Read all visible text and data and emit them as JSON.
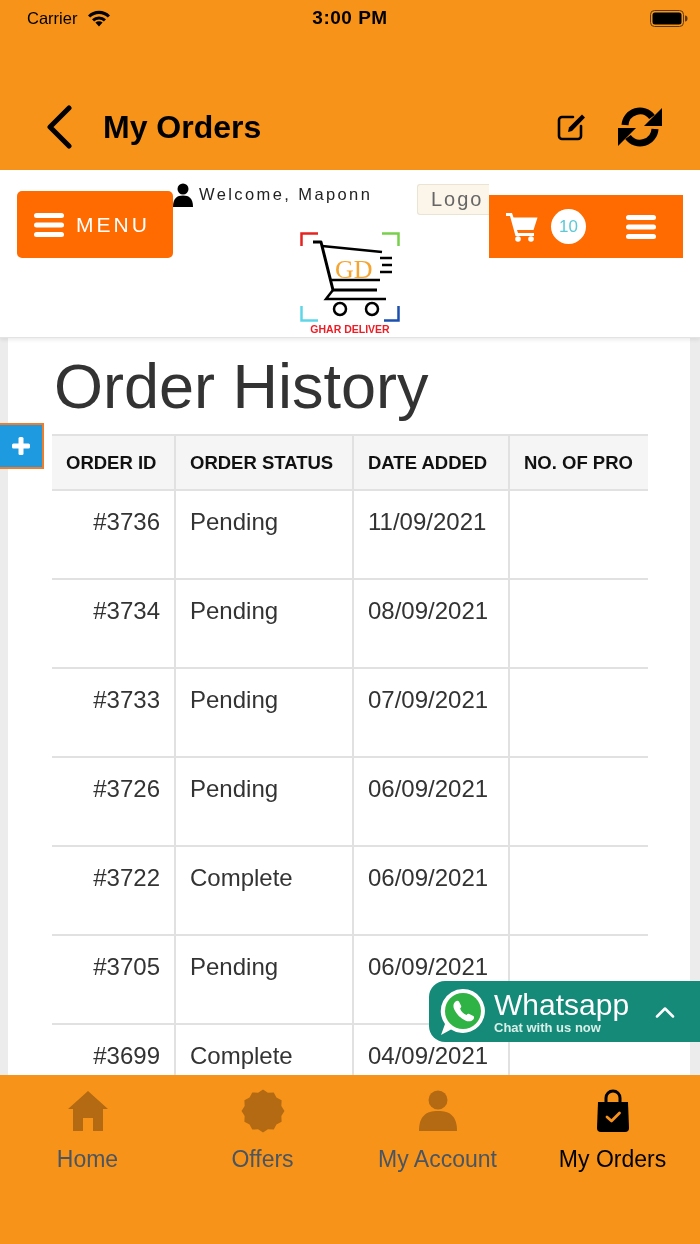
{
  "status_bar": {
    "carrier": "Carrier",
    "time": "3:00 PM"
  },
  "nav_bar": {
    "title": "My Orders"
  },
  "site_header": {
    "menu_button": "MENU",
    "welcome": "Welcome, Maponn",
    "logout_button": "Logo",
    "cart_count": "10",
    "logo_monogram": "GD",
    "logo_caption": "GHAR DELIVER"
  },
  "order_history": {
    "title": "Order History",
    "columns": [
      "ORDER ID",
      "ORDER STATUS",
      "DATE ADDED",
      "NO. OF PRO"
    ],
    "rows": [
      {
        "order_id": "#3736",
        "status": "Pending",
        "date_added": "11/09/2021"
      },
      {
        "order_id": "#3734",
        "status": "Pending",
        "date_added": "08/09/2021"
      },
      {
        "order_id": "#3733",
        "status": "Pending",
        "date_added": "07/09/2021"
      },
      {
        "order_id": "#3726",
        "status": "Pending",
        "date_added": "06/09/2021"
      },
      {
        "order_id": "#3722",
        "status": "Complete",
        "date_added": "06/09/2021"
      },
      {
        "order_id": "#3705",
        "status": "Pending",
        "date_added": "06/09/2021"
      },
      {
        "order_id": "#3699",
        "status": "Complete",
        "date_added": "04/09/2021"
      }
    ]
  },
  "whatsapp_widget": {
    "title": "Whatsapp",
    "subtitle": "Chat with us now"
  },
  "tab_bar": [
    {
      "label": "Home",
      "selected": false
    },
    {
      "label": "Offers",
      "selected": false
    },
    {
      "label": "My Account",
      "selected": false
    },
    {
      "label": "My Orders",
      "selected": true
    }
  ]
}
